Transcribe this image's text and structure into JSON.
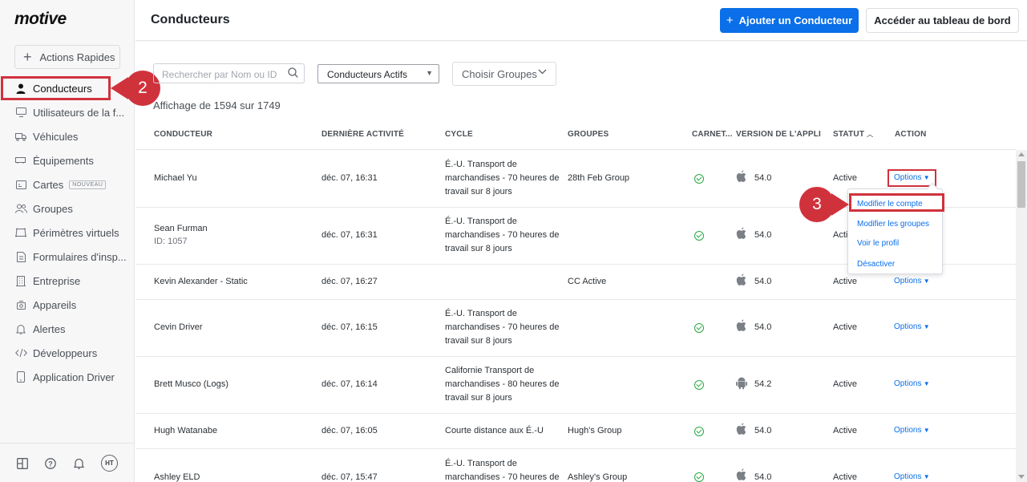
{
  "app": {
    "logo": "motive"
  },
  "sidebar": {
    "quick_actions": "Actions Rapides",
    "items": [
      {
        "label": "Conducteurs",
        "icon": "person-icon",
        "active": true
      },
      {
        "label": "Utilisateurs de la f...",
        "icon": "monitor-icon"
      },
      {
        "label": "Véhicules",
        "icon": "truck-icon"
      },
      {
        "label": "Équipements",
        "icon": "trailer-icon"
      },
      {
        "label": "Cartes",
        "icon": "map-icon",
        "badge": "NOUVEAU"
      },
      {
        "label": "Groupes",
        "icon": "group-icon"
      },
      {
        "label": "Périmètres virtuels",
        "icon": "geofence-icon"
      },
      {
        "label": "Formulaires d'insp...",
        "icon": "form-icon"
      },
      {
        "label": "Entreprise",
        "icon": "building-icon"
      },
      {
        "label": "Appareils",
        "icon": "devices-icon"
      },
      {
        "label": "Alertes",
        "icon": "bell-icon"
      },
      {
        "label": "Développeurs",
        "icon": "code-icon"
      },
      {
        "label": "Application Driver",
        "icon": "phone-icon"
      }
    ],
    "user_initials": "HT"
  },
  "header": {
    "title": "Conducteurs",
    "add_driver": "Ajouter un Conducteur",
    "dashboard": "Accéder au tableau de bord"
  },
  "filters": {
    "search_placeholder": "Rechercher par Nom ou ID",
    "status_filter": "Conducteurs Actifs",
    "groups_filter": "Choisir Groupes"
  },
  "count_text": "Affichage de 1594 sur 1749",
  "table": {
    "headers": {
      "driver": "CONDUCTEUR",
      "last_activity": "DERNIÈRE ACTIVITÉ",
      "cycle": "CYCLE",
      "groups": "GROUPES",
      "logbook": "CARNET...",
      "app_version": "VERSION DE L'APPLI",
      "status": "STATUT",
      "action": "ACTION"
    },
    "rows": [
      {
        "name": "Michael Yu",
        "id": "",
        "last": "déc. 07, 16:31",
        "cycle": [
          "É.-U. Transport de",
          "marchandises - 70 heures de",
          "travail sur 8 jours"
        ],
        "group": "28th Feb Group",
        "log": true,
        "os": "apple",
        "version": "54.0",
        "status": "Active",
        "action": "Options"
      },
      {
        "name": "Sean Furman",
        "id": "ID: 1057",
        "last": "déc. 07, 16:31",
        "cycle": [
          "É.-U. Transport de",
          "marchandises - 70 heures de",
          "travail sur 8 jours"
        ],
        "group": "",
        "log": true,
        "os": "apple",
        "version": "54.0",
        "status": "Active",
        "action": ""
      },
      {
        "name": "Kevin Alexander - Static",
        "id": "",
        "last": "déc. 07, 16:27",
        "cycle": [],
        "group": "CC Active",
        "log": false,
        "os": "apple",
        "version": "54.0",
        "status": "Active",
        "action": "Options"
      },
      {
        "name": "Cevin Driver",
        "id": "",
        "last": "déc. 07, 16:15",
        "cycle": [
          "É.-U. Transport de",
          "marchandises - 70 heures de",
          "travail sur 8 jours"
        ],
        "group": "",
        "log": true,
        "os": "apple",
        "version": "54.0",
        "status": "Active",
        "action": "Options"
      },
      {
        "name": "Brett Musco (Logs)",
        "id": "",
        "last": "déc. 07, 16:14",
        "cycle": [
          "Californie Transport de",
          "marchandises - 80 heures de",
          "travail sur 8 jours"
        ],
        "group": "",
        "log": true,
        "os": "android",
        "version": "54.2",
        "status": "Active",
        "action": "Options"
      },
      {
        "name": "Hugh Watanabe",
        "id": "",
        "last": "déc. 07, 16:05",
        "cycle": [
          "Courte distance aux É.-U"
        ],
        "group": "Hugh's Group",
        "log": true,
        "os": "apple",
        "version": "54.0",
        "status": "Active",
        "action": "Options"
      },
      {
        "name": "Ashley ELD",
        "id": "",
        "last": "déc. 07, 15:47",
        "cycle": [
          "É.-U. Transport de",
          "marchandises - 70 heures de"
        ],
        "group": "Ashley's Group",
        "log": true,
        "os": "apple",
        "version": "54.0",
        "status": "Active",
        "action": "Options"
      }
    ]
  },
  "dropdown": {
    "items": [
      "Modifier le compte",
      "Modifier les groupes",
      "Voir le profil",
      "Désactiver"
    ]
  },
  "callouts": {
    "step2": "2",
    "step3": "3"
  },
  "colors": {
    "accent": "#0a6fe8",
    "highlight": "#d0323c",
    "success": "#28a745"
  }
}
